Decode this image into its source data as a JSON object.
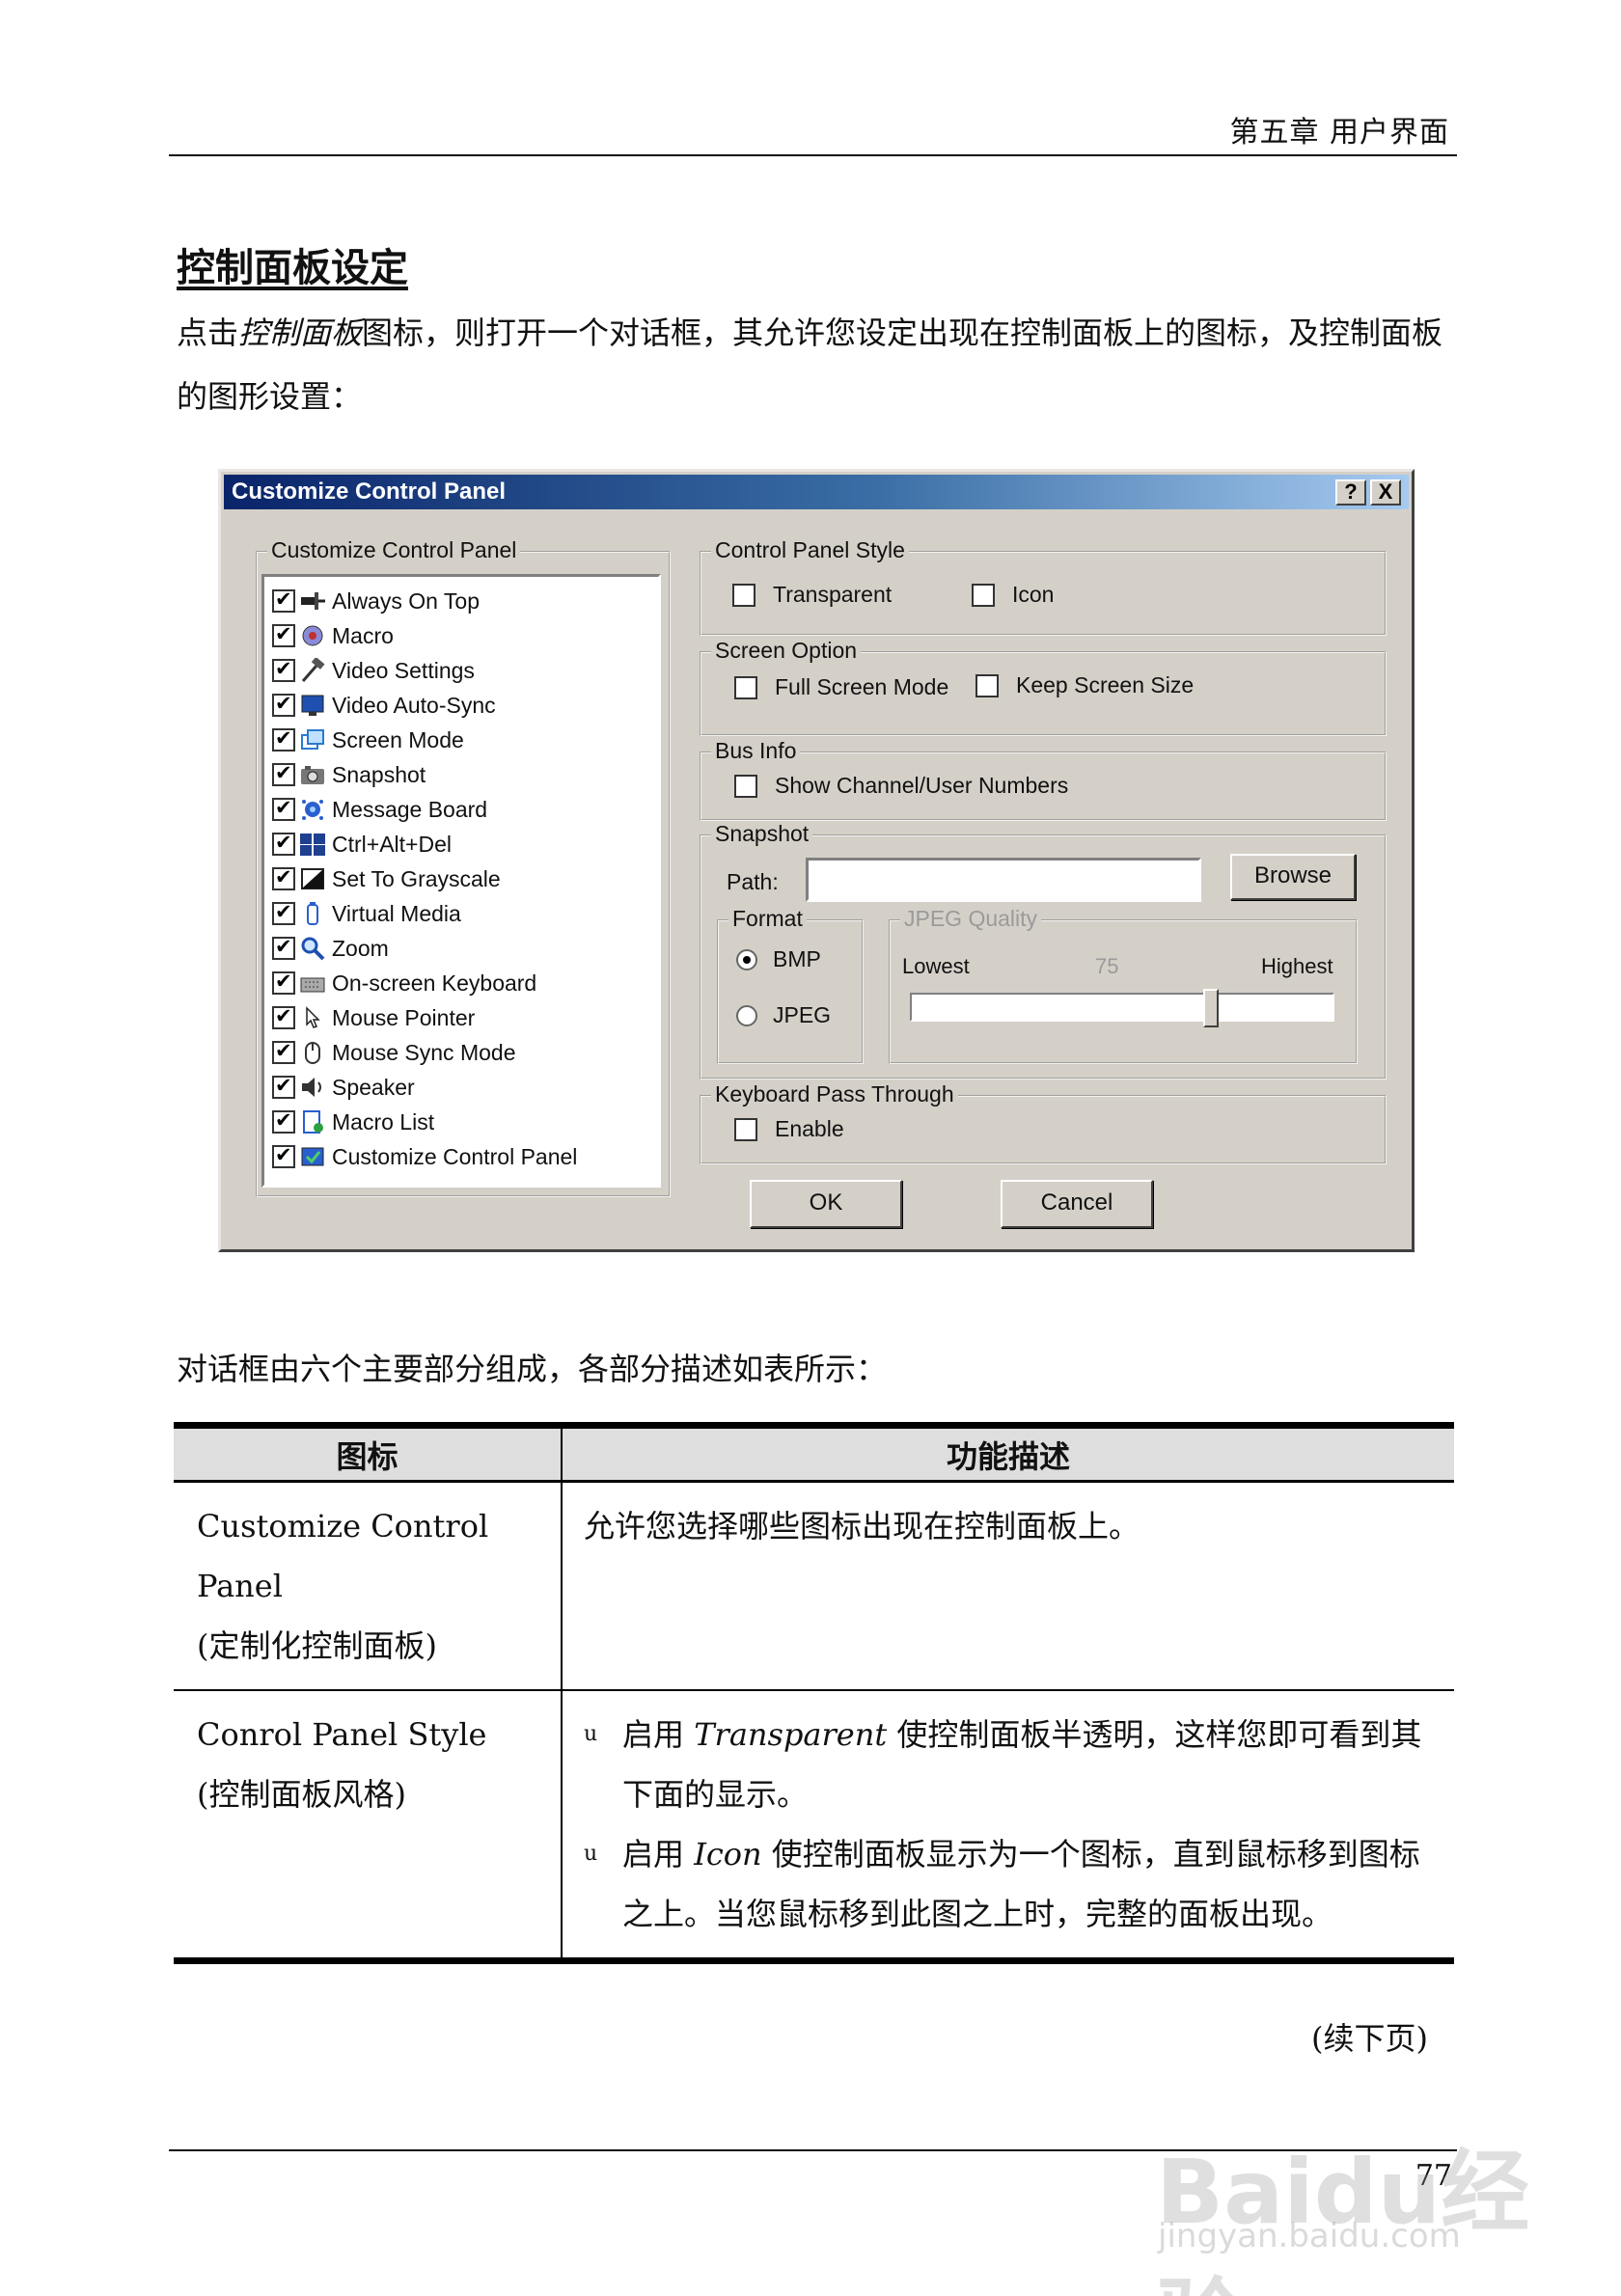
{
  "header": {
    "chapter": "第五章 用户界面"
  },
  "section": {
    "title": "控制面板设定",
    "intro_before": "点击",
    "intro_italic": "控制面板",
    "intro_after": "图标，则打开一个对话框，其允许您设定出现在控制面板上的图标，及控制面板的图形设置："
  },
  "dialog": {
    "title": "Customize Control Panel",
    "help_button": "?",
    "close_button": "X",
    "customize_group": {
      "legend": "Customize Control Panel",
      "items": [
        {
          "label": "Always On Top",
          "checked": true,
          "icon": "pin-icon"
        },
        {
          "label": "Macro",
          "checked": true,
          "icon": "macro-icon"
        },
        {
          "label": "Video Settings",
          "checked": true,
          "icon": "hammer-icon"
        },
        {
          "label": "Video Auto-Sync",
          "checked": true,
          "icon": "monitor-sync-icon"
        },
        {
          "label": "Screen Mode",
          "checked": true,
          "icon": "screen-mode-icon"
        },
        {
          "label": "Snapshot",
          "checked": true,
          "icon": "camera-icon"
        },
        {
          "label": "Message Board",
          "checked": true,
          "icon": "message-board-icon"
        },
        {
          "label": "Ctrl+Alt+Del",
          "checked": true,
          "icon": "keys-icon"
        },
        {
          "label": "Set To Grayscale",
          "checked": true,
          "icon": "grayscale-icon"
        },
        {
          "label": "Virtual Media",
          "checked": true,
          "icon": "virtual-media-icon"
        },
        {
          "label": "Zoom",
          "checked": true,
          "icon": "zoom-icon"
        },
        {
          "label": "On-screen Keyboard",
          "checked": true,
          "icon": "keyboard-icon"
        },
        {
          "label": "Mouse Pointer",
          "checked": true,
          "icon": "mouse-pointer-icon"
        },
        {
          "label": "Mouse Sync Mode",
          "checked": true,
          "icon": "mouse-icon"
        },
        {
          "label": "Speaker",
          "checked": true,
          "icon": "speaker-icon"
        },
        {
          "label": "Macro List",
          "checked": true,
          "icon": "macro-list-icon"
        },
        {
          "label": "Customize Control Panel",
          "checked": true,
          "icon": "customize-icon"
        }
      ]
    },
    "style_group": {
      "legend": "Control Panel Style",
      "transparent": "Transparent",
      "icon": "Icon"
    },
    "screen_group": {
      "legend": "Screen Option",
      "full_screen": "Full Screen Mode",
      "keep_size": "Keep Screen Size"
    },
    "bus_group": {
      "legend": "Bus Info",
      "show_numbers": "Show Channel/User Numbers"
    },
    "snapshot_group": {
      "legend": "Snapshot",
      "path_label": "Path:",
      "path_value": "",
      "browse": "Browse",
      "format_legend": "Format",
      "bmp": "BMP",
      "jpeg": "JPEG",
      "format_selected": "BMP",
      "quality_legend": "JPEG Quality",
      "lowest": "Lowest",
      "quality_value": "75",
      "highest": "Highest",
      "quality_level": 0.72
    },
    "kbd_group": {
      "legend": "Keyboard Pass Through",
      "enable": "Enable"
    },
    "ok": "OK",
    "cancel": "Cancel"
  },
  "para2": "对话框由六个主要部分组成，各部分描述如表所示：",
  "table": {
    "headers": [
      "图标",
      "功能描述"
    ],
    "rows": [
      {
        "name_line1": "Customize Control Panel",
        "name_line2": "(定制化控制面板)",
        "desc": "允许您选择哪些图标出现在控制面板上。"
      },
      {
        "name_line1": "Conrol Panel Style",
        "name_line2": "(控制面板风格)",
        "bullet": "u",
        "b1_pre": "启用 ",
        "b1_em": "Transparent",
        "b1_post": " 使控制面板半透明，这样您即可看到其下面的显示。",
        "b2_pre": "启用 ",
        "b2_em": "Icon",
        "b2_post": " 使控制面板显示为一个图标，直到鼠标移到图标之上。当您鼠标移到此图之上时，完整的面板出现。"
      }
    ]
  },
  "continued": "(续下页)",
  "page_number": "77",
  "watermark": {
    "brand": "Baidu经验",
    "url": "jingyan.baidu.com"
  }
}
